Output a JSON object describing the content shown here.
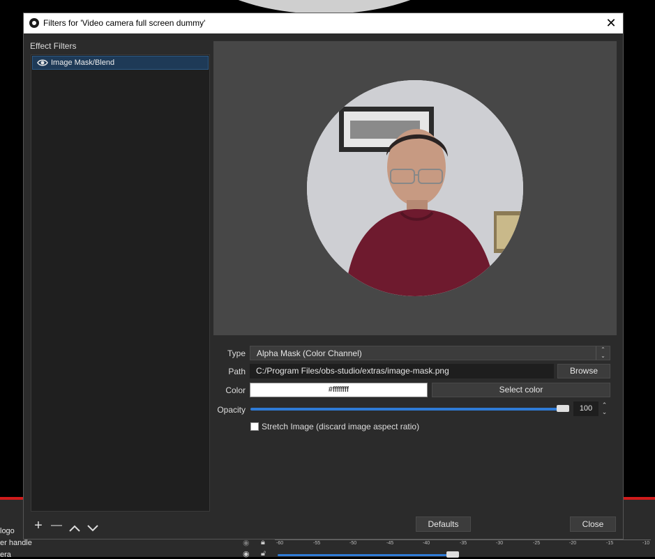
{
  "window": {
    "title": "Filters for 'Video camera full screen dummy'",
    "close_glyph": "✕"
  },
  "filters_panel": {
    "label": "Effect Filters",
    "items": [
      {
        "name": "Image Mask/Blend",
        "icon": "eye-icon",
        "selected": true
      }
    ],
    "buttons": {
      "add": "+",
      "remove": "—",
      "up": "⌃",
      "down": "⌄"
    }
  },
  "settings": {
    "type_label": "Type",
    "type_value": "Alpha Mask (Color Channel)",
    "path_label": "Path",
    "path_value": "C:/Program Files/obs-studio/extras/image-mask.png",
    "browse_label": "Browse",
    "color_label": "Color",
    "color_value": "#ffffffff",
    "select_color_label": "Select color",
    "opacity_label": "Opacity",
    "opacity_value": "100",
    "opacity_fraction": 1.0,
    "stretch_label": "Stretch Image (discard image aspect ratio)",
    "stretch_checked": false
  },
  "footer": {
    "defaults_label": "Defaults",
    "close_label": "Close"
  },
  "background": {
    "sources": [
      "logo",
      "er handle",
      "era"
    ],
    "meter_ticks": [
      "-60",
      "-55",
      "-50",
      "-45",
      "-40",
      "-35",
      "-30",
      "-25",
      "-20",
      "-15",
      "-10"
    ],
    "accent_color": "#2f7bd6",
    "alert_color": "#d01b1b"
  }
}
